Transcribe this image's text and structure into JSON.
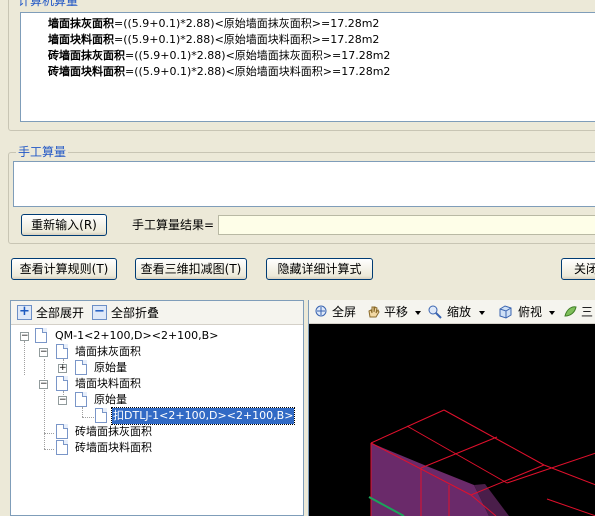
{
  "calc_section": {
    "title": "计算机算量",
    "lines": [
      {
        "label": "墙面抹灰面积",
        "formula": "=((5.9+0.1)*2.88)<原始墙面抹灰面积>=17.28m2"
      },
      {
        "label": "墙面块料面积",
        "formula": "=((5.9+0.1)*2.88)<原始墙面块料面积>=17.28m2"
      },
      {
        "label": "砖墙面抹灰面积",
        "formula": "=((5.9+0.1)*2.88)<原始墙面抹灰面积>=17.28m2"
      },
      {
        "label": "砖墙面块料面积",
        "formula": "=((5.9+0.1)*2.88)<原始墙面块料面积>=17.28m2"
      }
    ]
  },
  "manual_section": {
    "title": "手工算量",
    "reinput_label": "重新输入(R)",
    "result_label": "手工算量结果="
  },
  "actions": {
    "view_rules": "查看计算规则(T)",
    "view_3d": "查看三维扣减图(T)",
    "hide_detail": "隐藏详细计算式",
    "close": "关闭"
  },
  "tree_toolbar": {
    "expand_all": "全部展开",
    "collapse_all": "全部折叠"
  },
  "tree": {
    "root": "QM-1<2+100,D><2+100,B>",
    "n1": "墙面抹灰面积",
    "n1_child": "原始量",
    "n2": "墙面块料面积",
    "n2_child": "原始量",
    "n2_leaf": "扣DTLJ-1<2+100,D><2+100,B>",
    "n3": "砖墙面抹灰面积",
    "n4": "砖墙面块料面积"
  },
  "view_toolbar": {
    "fullscreen": "全屏",
    "pan": "平移",
    "zoom": "缩放",
    "view": "俯视",
    "three": "三"
  },
  "colors": {
    "grid_lines": "#e0102c",
    "wall_fill": "#6a2a6a",
    "selection": "#316ac5",
    "title_blue": "#2157c6"
  }
}
